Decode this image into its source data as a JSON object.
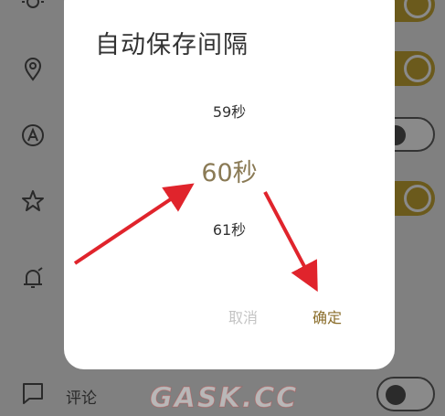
{
  "dialog": {
    "title": "自动保存间隔",
    "picker": {
      "previous": "59秒",
      "selected": "60秒",
      "next": "61秒"
    },
    "cancel_label": "取消",
    "ok_label": "确定"
  },
  "background": {
    "comment_label": "评论"
  },
  "watermark": "GASK.CC",
  "colors": {
    "accent": "#8a6d2a",
    "toggle_on": "#6b5a1c",
    "arrow": "#e0242c"
  }
}
